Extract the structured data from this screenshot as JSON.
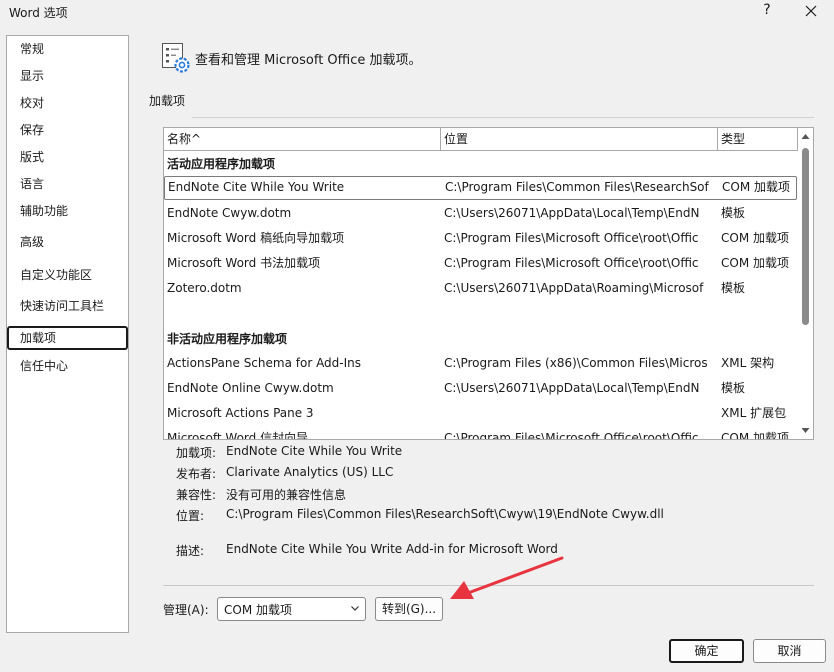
{
  "window": {
    "title": "Word 选项",
    "help_label": "?"
  },
  "nav": {
    "items": [
      {
        "label": "常规"
      },
      {
        "label": "显示"
      },
      {
        "label": "校对"
      },
      {
        "label": "保存"
      },
      {
        "label": "版式"
      },
      {
        "label": "语言"
      },
      {
        "label": "辅助功能"
      },
      {
        "label": "高级"
      },
      {
        "label": "自定义功能区"
      },
      {
        "label": "快速访问工具栏"
      },
      {
        "label": "加载项"
      },
      {
        "label": "信任中心"
      }
    ],
    "selected": "加载项"
  },
  "header": {
    "text": "查看和管理 Microsoft Office 加载项。",
    "icon": "addins-gear-icon"
  },
  "section": {
    "title": "加载项"
  },
  "table": {
    "columns": {
      "name": "名称",
      "sort_indicator": "^",
      "location": "位置",
      "type": "类型"
    },
    "group_active": "活动应用程序加载项",
    "group_inactive": "非活动应用程序加载项",
    "active_rows": [
      {
        "name": "EndNote Cite While You Write",
        "location": "C:\\Program Files\\Common Files\\ResearchSof",
        "type": "COM 加载项"
      },
      {
        "name": "EndNote Cwyw.dotm",
        "location": "C:\\Users\\26071\\AppData\\Local\\Temp\\EndN",
        "type": "模板"
      },
      {
        "name": "Microsoft Word 稿纸向导加载项",
        "location": "C:\\Program Files\\Microsoft Office\\root\\Offic",
        "type": "COM 加载项"
      },
      {
        "name": "Microsoft Word 书法加载项",
        "location": "C:\\Program Files\\Microsoft Office\\root\\Offic",
        "type": "COM 加载项"
      },
      {
        "name": "Zotero.dotm",
        "location": "C:\\Users\\26071\\AppData\\Roaming\\Microsof",
        "type": "模板"
      }
    ],
    "inactive_rows": [
      {
        "name": "ActionsPane Schema for Add-Ins",
        "location": "C:\\Program Files (x86)\\Common Files\\Micros",
        "type": "XML 架构"
      },
      {
        "name": "EndNote Online Cwyw.dotm",
        "location": "C:\\Users\\26071\\AppData\\Local\\Temp\\EndN",
        "type": "模板"
      },
      {
        "name": "Microsoft Actions Pane 3",
        "location": "",
        "type": "XML 扩展包"
      },
      {
        "name": "Microsoft Word 信封向导",
        "location": "C:\\Program Files\\Microsoft Office\\root\\Offic",
        "type": "COM 加载项"
      }
    ]
  },
  "details": {
    "addin_label": "加载项:",
    "addin_value": "EndNote Cite While You Write",
    "publisher_label": "发布者:",
    "publisher_value": "Clarivate Analytics (US) LLC",
    "compat_label": "兼容性:",
    "compat_value": "没有可用的兼容性信息",
    "location_label": "位置:",
    "location_value": "C:\\Program Files\\Common Files\\ResearchSoft\\Cwyw\\19\\EndNote Cwyw.dll",
    "desc_label": "描述:",
    "desc_value": "EndNote Cite While You Write Add-in for Microsoft Word"
  },
  "manage": {
    "label": "管理(A):",
    "selected": "COM 加载项",
    "goto_label": "转到(G)..."
  },
  "buttons": {
    "ok": "确定",
    "cancel": "取消"
  },
  "colors": {
    "annotation_arrow": "#e8343f",
    "scroll_thumb": "#8a8a8a"
  }
}
